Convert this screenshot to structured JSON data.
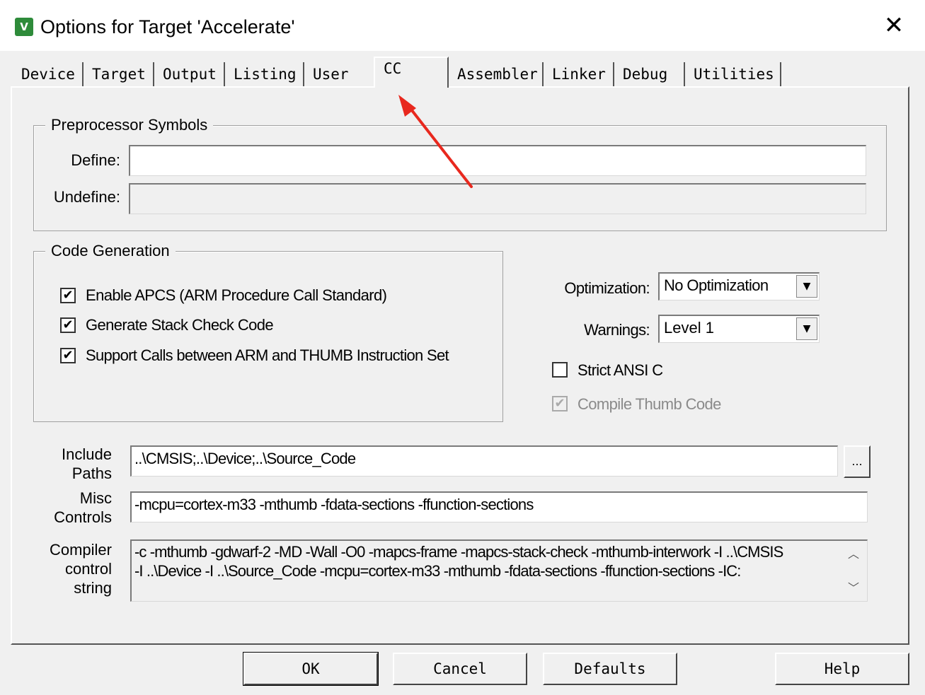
{
  "window": {
    "title": "Options for Target 'Accelerate'",
    "close_label": "✕",
    "icon_label": "V"
  },
  "tabs": [
    "Device",
    "Target",
    "Output",
    "Listing",
    "User",
    "CC",
    "Assembler",
    "Linker",
    "Debug",
    "Utilities"
  ],
  "active_tab": "CC",
  "preprocessor": {
    "group_label": "Preprocessor Symbols",
    "define_label": "Define:",
    "define_value": "",
    "undefine_label": "Undefine:",
    "undefine_value": ""
  },
  "code_generation": {
    "group_label": "Code Generation",
    "options": [
      {
        "label": "Enable APCS (ARM Procedure Call Standard)",
        "checked": true
      },
      {
        "label": "Generate Stack Check Code",
        "checked": true
      },
      {
        "label": "Support Calls between ARM and THUMB Instruction Set",
        "checked": true
      }
    ]
  },
  "optimization": {
    "label": "Optimization:",
    "value": "No Optimization"
  },
  "warnings": {
    "label": "Warnings:",
    "value": "Level 1"
  },
  "strict_ansi": {
    "label": "Strict ANSI C",
    "checked": false
  },
  "compile_thumb": {
    "label": "Compile Thumb Code",
    "checked": true,
    "disabled": true
  },
  "include_paths": {
    "label_line1": "Include",
    "label_line2": "Paths",
    "value": "..\\CMSIS;..\\Device;..\\Source_Code",
    "browse_label": "..."
  },
  "misc_controls": {
    "label_line1": "Misc",
    "label_line2": "Controls",
    "value": "-mcpu=cortex-m33 -mthumb -fdata-sections -ffunction-sections"
  },
  "compiler_control": {
    "label_line1": "Compiler",
    "label_line2": "control",
    "label_line3": "string",
    "line1": "-c -mthumb -gdwarf-2 -MD -Wall -O0 -mapcs-frame -mapcs-stack-check -mthumb-interwork -I ..\\CMSIS",
    "line2": "-I ..\\Device -I ..\\Source_Code -mcpu=cortex-m33 -mthumb -fdata-sections -ffunction-sections -IC:"
  },
  "buttons": {
    "ok": "OK",
    "cancel": "Cancel",
    "defaults": "Defaults",
    "help": "Help"
  },
  "colors": {
    "annotation_arrow": "#e8281e",
    "app_icon": "#2e8b3a"
  }
}
